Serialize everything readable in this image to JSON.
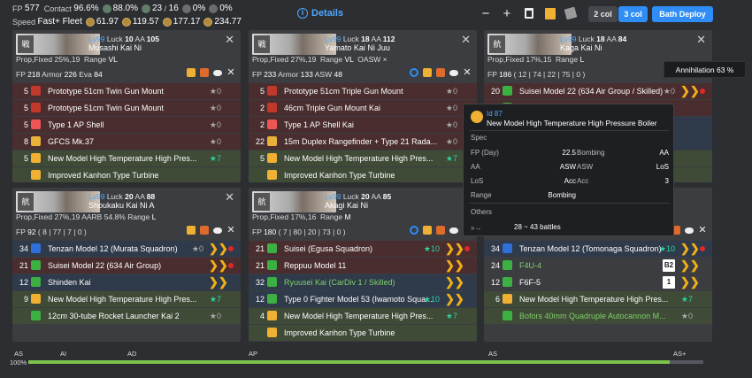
{
  "header": {
    "fp_label": "FP",
    "fp": "577",
    "contact_label": "Contact",
    "contact": "96.6%",
    "contact2": "88.0%",
    "tp": "23",
    "ac": "16",
    "fuel_pct": "0%",
    "ammo_pct": "0%",
    "speed_label": "Speed",
    "speed": "Fast+ Fleet",
    "ap1": "61.97",
    "ap2": "119.57",
    "ap3": "177.17",
    "ap4": "234.77",
    "details": "Details"
  },
  "toolbar": {
    "col2": "2 col",
    "col3": "3 col",
    "deploy": "Bath Deploy"
  },
  "annihilation": "Annihilation 63 %",
  "ships": [
    {
      "lv": "Lv99",
      "luck_l": "Luck",
      "luck": "10",
      "aa_l": "AA",
      "aa": "105",
      "name": "Musashi Kai Ni",
      "prop": "Prop,Fixed 25%,19",
      "range_l": "Range",
      "range": "VL",
      "fp": "218",
      "armor": "226",
      "eva": "84",
      "items": [
        {
          "n": "5",
          "t": "Prototype 51cm Twin Gun Mount",
          "p": "★0",
          "cls": "rr",
          "ic": "#c0392b"
        },
        {
          "n": "5",
          "t": "Prototype 51cm Twin Gun Mount",
          "p": "★0",
          "cls": "rr",
          "ic": "#c0392b"
        },
        {
          "n": "5",
          "t": "Type 1 AP Shell",
          "p": "★0",
          "cls": "rr",
          "ic": "#e55"
        },
        {
          "n": "8",
          "t": "GFCS Mk.37",
          "p": "★0",
          "cls": "rr",
          "ic": "#e8b23a"
        },
        {
          "n": "5",
          "t": "New Model High Temperature High Pres...",
          "p": "★7",
          "cls": "rg",
          "ic": "#f0b033",
          "pc": true
        },
        {
          "n": "",
          "t": "Improved Kanhon Type Turbine",
          "p": "",
          "cls": "rg",
          "ic": "#f0b033"
        }
      ]
    },
    {
      "lv": "Lv99",
      "luck_l": "Luck",
      "luck": "18",
      "aa_l": "AA",
      "aa": "112",
      "name": "Yamato Kai Ni Juu",
      "prop": "Prop,Fixed 27%,19",
      "range_l": "Range",
      "range": "VL",
      "fp": "233",
      "armor": "133",
      "eva": "48",
      "oasw": "OASW ×",
      "items": [
        {
          "n": "5",
          "t": "Prototype 51cm Triple Gun Mount",
          "p": "★0",
          "cls": "rr",
          "ic": "#c0392b"
        },
        {
          "n": "2",
          "t": "46cm Triple Gun Mount Kai",
          "p": "★0",
          "cls": "rr",
          "ic": "#c0392b"
        },
        {
          "n": "2",
          "t": "Type 1 AP Shell Kai",
          "p": "★0",
          "cls": "rr",
          "ic": "#e55"
        },
        {
          "n": "22",
          "t": "15m Duplex Rangefinder + Type 21 Rada...",
          "p": "★0",
          "cls": "rr",
          "ic": "#e8b23a"
        },
        {
          "n": "5",
          "t": "New Model High Temperature High Pres...",
          "p": "★7",
          "cls": "rg",
          "ic": "#f0b033",
          "pc": true
        },
        {
          "n": "",
          "t": "Improved Kanhon Type Turbine",
          "p": "",
          "cls": "rg",
          "ic": "#f0b033"
        }
      ]
    },
    {
      "lv": "Lv99",
      "luck_l": "Luck",
      "luck": "18",
      "aa_l": "AA",
      "aa": "84",
      "name": "Kaga Kai Ni",
      "prop": "Prop,Fixed 17%,15",
      "range_l": "Range",
      "range": "L",
      "fp": "186",
      "fpd": "( 12 | 74 | 22 | 75 | 0 )",
      "items": [
        {
          "n": "20",
          "t": "Suisei Model 22 (634 Air Group / Skilled)",
          "p": "★0",
          "cls": "rr",
          "ic": "#3cb043",
          "ch": true,
          "dot": true
        },
        {
          "n": "",
          "t": "",
          "p": "",
          "cls": "rr",
          "ic": "#3cb043"
        },
        {
          "n": "",
          "t": "",
          "p": "",
          "cls": "rb",
          "ic": "#3cb043"
        },
        {
          "n": "",
          "t": "",
          "p": "",
          "cls": "rb",
          "ic": "#3cb043"
        },
        {
          "n": "",
          "t": "",
          "p": "",
          "cls": "rg",
          "ic": "#3cb043"
        },
        {
          "n": "",
          "t": "",
          "p": "",
          "cls": "rg",
          "ic": "#3cb043"
        }
      ]
    },
    {
      "lv": "Lv99",
      "luck_l": "Luck",
      "luck": "20",
      "aa_l": "AA",
      "aa": "88",
      "name": "Shoukaku Kai Ni A",
      "prop": "Prop,Fixed 27%,19",
      "aarb": "AARB 54.8%",
      "range_l": "Range",
      "range": "L",
      "fp": "92",
      "fpd": "( 8 | 77 | 7 | 0 )",
      "items": [
        {
          "n": "34",
          "t": "Tenzan Model 12 (Murata Squadron)",
          "p": "★0",
          "cls": "rb",
          "ic": "#2f6fd8",
          "ch": true,
          "dot": true
        },
        {
          "n": "21",
          "t": "Suisei Model 22 (634 Air Group)",
          "p": "",
          "cls": "rr",
          "ic": "#3cb043",
          "ch": true,
          "dot": true
        },
        {
          "n": "12",
          "t": "Shinden Kai",
          "p": "",
          "cls": "rb",
          "ic": "#3cb043",
          "ch": true
        },
        {
          "n": "9",
          "t": "New Model High Temperature High Pres...",
          "p": "★7",
          "cls": "rg",
          "ic": "#f0b033",
          "pc": true
        },
        {
          "n": "",
          "t": "12cm 30-tube Rocket Launcher Kai 2",
          "p": "★0",
          "cls": "rg",
          "ic": "#3cb043"
        }
      ]
    },
    {
      "lv": "Lv99",
      "luck_l": "Luck",
      "luck": "20",
      "aa_l": "AA",
      "aa": "85",
      "name": "Akagi Kai Ni",
      "prop": "Prop,Fixed 17%,16",
      "range_l": "Range",
      "range": "M",
      "fp": "180",
      "fpd": "( 7 | 80 | 20 | 73 | 0 )",
      "items": [
        {
          "n": "21",
          "t": "Suisei (Egusa Squadron)",
          "p": "★10",
          "cls": "rr",
          "ic": "#3cb043",
          "ch": true,
          "dot": true,
          "pc": true
        },
        {
          "n": "21",
          "t": "Reppuu Model 11",
          "p": "",
          "cls": "rr",
          "ic": "#3cb043",
          "ch": true
        },
        {
          "n": "32",
          "t": "Ryuusei Kai (CarDiv 1 / Skilled)",
          "p": "",
          "cls": "rb",
          "ic": "#3cb043",
          "ch": true,
          "green": true
        },
        {
          "n": "12",
          "t": "Type 0 Fighter Model 53 (Iwamoto Squa...",
          "p": "★10",
          "cls": "rb",
          "ic": "#3cb043",
          "ch": true,
          "pc": true
        },
        {
          "n": "4",
          "t": "New Model High Temperature High Pres...",
          "p": "★7",
          "cls": "rg",
          "ic": "#f0b033",
          "pc": true
        },
        {
          "n": "",
          "t": "Improved Kanhon Type Turbine",
          "p": "",
          "cls": "rg",
          "ic": "#f0b033"
        }
      ]
    },
    {
      "items": [
        {
          "n": "34",
          "t": "Tenzan Model 12 (Tomonaga Squadron)",
          "p": "★10",
          "cls": "rb",
          "ic": "#2f6fd8",
          "ch": true,
          "dot": true,
          "pc": true
        },
        {
          "n": "24",
          "t": "F4U-4",
          "p": "B2",
          "cls": "rn",
          "ic": "#3cb043",
          "ch": true,
          "green": true,
          "badge": true
        },
        {
          "n": "12",
          "t": "F6F-5",
          "p": "1",
          "cls": "rn",
          "ic": "#3cb043",
          "ch": true,
          "badge": true
        },
        {
          "n": "6",
          "t": "New Model High Temperature High Pres...",
          "p": "★7",
          "cls": "rg",
          "ic": "#f0b033",
          "pc": true
        },
        {
          "n": "",
          "t": "Bofors 40mm Quadruple Autocannon M...",
          "p": "★0",
          "cls": "rg",
          "ic": "#3cb043",
          "green": true
        }
      ]
    }
  ],
  "tooltip": {
    "id": "Id 87",
    "name": "New Model High Temperature High Pressure Boiler",
    "spec": "Spec",
    "fp_day_l": "FP (Day)",
    "fp_day": "22.5",
    "bombing_l": "Bombing",
    "aa_l": "AA",
    "aa_v": "ASW",
    "asw_l": "ASW",
    "asw_v": "LoS",
    "los_l": "LoS",
    "los_v": "Acc",
    "acc_l": "Acc",
    "acc_v": "3",
    "range_l": "Range",
    "range_v": "Bombing",
    "bomb_v": "AA",
    "aa2": "LoS",
    "others": "Others",
    "battles": "28 ~ 43 battles"
  },
  "as_bar": {
    "pct": "100%",
    "labels": [
      "AS",
      "AI",
      "AD",
      "AP",
      "AS",
      "AS+"
    ],
    "fill": 0.95
  }
}
